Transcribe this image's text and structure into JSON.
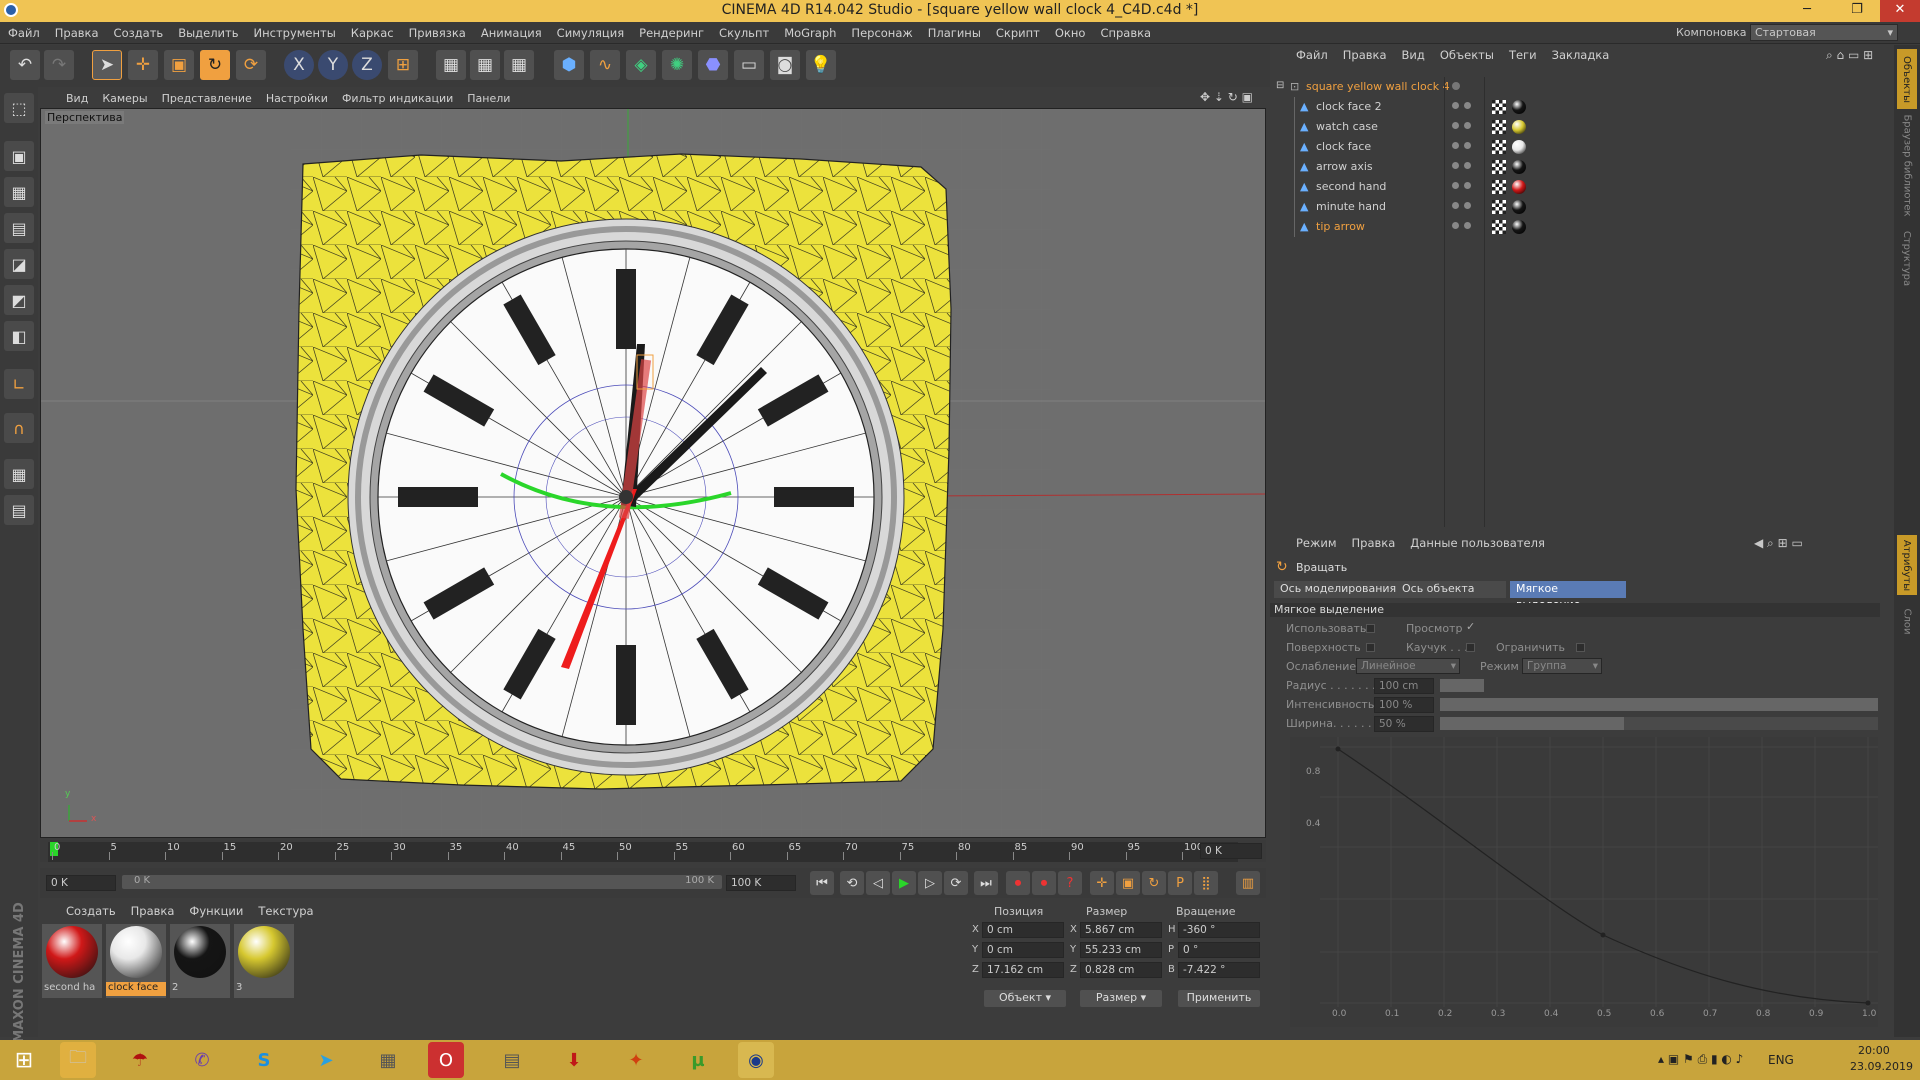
{
  "window": {
    "title": "CINEMA 4D R14.042 Studio - [square yellow wall clock 4_C4D.c4d *]",
    "min": "─",
    "max": "❐",
    "close": "✕"
  },
  "menu": [
    "Файл",
    "Правка",
    "Создать",
    "Выделить",
    "Инструменты",
    "Каркас",
    "Привязка",
    "Анимация",
    "Симуляция",
    "Рендеринг",
    "Скульпт",
    "MoGraph",
    "Персонаж",
    "Плагины",
    "Скрипт",
    "Окно",
    "Справка"
  ],
  "layout": {
    "label": "Компоновка",
    "value": "Стартовая"
  },
  "toolbar": {
    "undo": "↶",
    "redo": "↷",
    "select": "➤",
    "move": "✛",
    "scale": "▣",
    "rotate": "↻",
    "rotate2": "⟳",
    "x": "X",
    "y": "Y",
    "z": "Z",
    "coord": "⊞",
    "render1": "▦",
    "render2": "▦",
    "render3": "▦",
    "cube": "⬢",
    "spline": "∿",
    "nurbs": "◈",
    "array": "✺",
    "deformer": "⬣",
    "floor": "▭",
    "camera": "◙",
    "light": "💡"
  },
  "lefttools": [
    "⬚",
    "▣",
    "▦",
    "▤",
    "◪",
    "◩",
    "◧",
    "∟",
    "∩",
    "▦",
    "▤"
  ],
  "viewport": {
    "menu": [
      "Вид",
      "Камеры",
      "Представление",
      "Настройки",
      "Фильтр индикации",
      "Панели"
    ],
    "label": "Перспектива",
    "axis_y": "y",
    "axis_x": "x"
  },
  "timeline": {
    "ticks": [
      "0",
      "5",
      "10",
      "15",
      "20",
      "25",
      "30",
      "35",
      "40",
      "45",
      "50",
      "55",
      "60",
      "65",
      "70",
      "75",
      "80",
      "85",
      "90",
      "95",
      "100"
    ],
    "current_frame": "0 K"
  },
  "transport": {
    "start": "0 K",
    "range_start": "0 K",
    "range_end": "100 K",
    "end": "100 K"
  },
  "materials": {
    "menu": [
      "Создать",
      "Правка",
      "Функции",
      "Текстура"
    ],
    "items": [
      {
        "name": "second ha",
        "color": "#d01818"
      },
      {
        "name": "clock face",
        "color": "#e8e8e8",
        "selected": true
      },
      {
        "name": "2",
        "color": "#151515"
      },
      {
        "name": "3",
        "color": "#d6c830"
      }
    ]
  },
  "coords": {
    "headers": [
      "Позиция",
      "Размер",
      "Вращение"
    ],
    "rows": [
      {
        "axis": "X",
        "pos": "0 cm",
        "saxis": "X",
        "size": "5.867 cm",
        "raxis": "H",
        "rot": "-360 °"
      },
      {
        "axis": "Y",
        "pos": "0 cm",
        "saxis": "Y",
        "size": "55.233 cm",
        "raxis": "P",
        "rot": "0 °"
      },
      {
        "axis": "Z",
        "pos": "17.162 cm",
        "saxis": "Z",
        "size": "0.828 cm",
        "raxis": "B",
        "rot": "-7.422 °"
      }
    ],
    "mode1": "Объект",
    "mode2": "Размер",
    "apply": "Применить"
  },
  "objects": {
    "menu": [
      "Файл",
      "Правка",
      "Вид",
      "Объекты",
      "Теги",
      "Закладка"
    ],
    "root": "square yellow wall clock 4",
    "items": [
      "clock face 2",
      "watch case",
      "clock face",
      "arrow axis",
      "second hand",
      "minute hand",
      "tip arrow"
    ],
    "tag_colors": [
      "#151515",
      "#d6c830",
      "#e8e8e8",
      "#151515",
      "#d01818",
      "#151515",
      "#151515"
    ]
  },
  "attributes": {
    "menu": [
      "Режим",
      "Правка",
      "Данные пользователя"
    ],
    "tool": "Вращать",
    "tabs": [
      "Ось моделирования",
      "Ось объекта",
      "Мягкое выделение"
    ],
    "section": "Мягкое выделение",
    "use": "Использовать",
    "preview": "Просмотр",
    "surface": "Поверхность",
    "rubber": "Каучук . . .",
    "restrict": "Ограничить",
    "falloff_label": "Ослабление",
    "falloff": "Линейное",
    "mode_label": "Режим",
    "mode": "Группа",
    "radius_label": "Радиус . . . . . . .",
    "radius": "100 cm",
    "intensity_label": "Интенсивность",
    "intensity": "100 %",
    "width_label": "Ширина. . . . . .",
    "width": "50 %",
    "graph_y": [
      "0.8",
      "0.4"
    ],
    "graph_x": [
      "0.0",
      "0.1",
      "0.2",
      "0.3",
      "0.4",
      "0.5",
      "0.6",
      "0.7",
      "0.8",
      "0.9",
      "1.0"
    ]
  },
  "rightstrip": [
    "Объекты",
    "Браузер библиотек",
    "Структура",
    "Атрибуты",
    "Слои"
  ],
  "tray": {
    "lang": "ENG",
    "time": "20:00",
    "date": "23.09.2019"
  },
  "brand": "MAXON CINEMA 4D"
}
